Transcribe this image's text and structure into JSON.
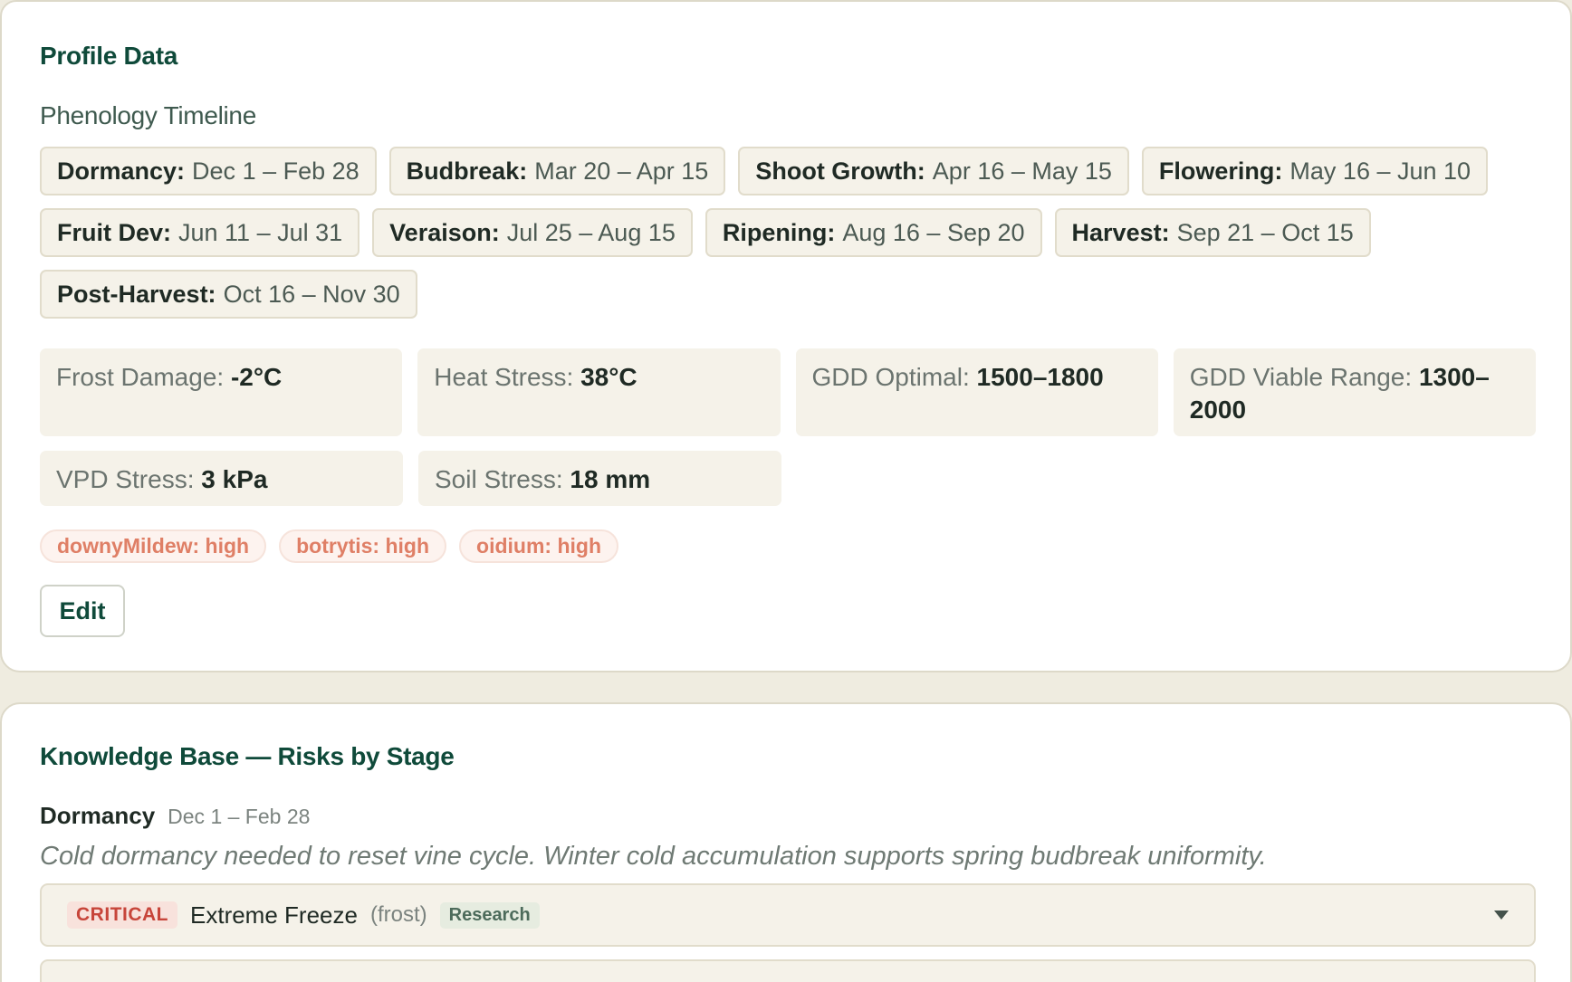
{
  "profile": {
    "title": "Profile Data",
    "phenology_title": "Phenology Timeline",
    "phenology": [
      {
        "stage": "Dormancy:",
        "range": "Dec 1 – Feb 28"
      },
      {
        "stage": "Budbreak:",
        "range": "Mar 20 – Apr 15"
      },
      {
        "stage": "Shoot Growth:",
        "range": "Apr 16 – May 15"
      },
      {
        "stage": "Flowering:",
        "range": "May 16 – Jun 10"
      },
      {
        "stage": "Fruit Dev:",
        "range": "Jun 11 – Jul 31"
      },
      {
        "stage": "Veraison:",
        "range": "Jul 25 – Aug 15"
      },
      {
        "stage": "Ripening:",
        "range": "Aug 16 – Sep 20"
      },
      {
        "stage": "Harvest:",
        "range": "Sep 21 – Oct 15"
      },
      {
        "stage": "Post-Harvest:",
        "range": "Oct 16 – Nov 30"
      }
    ],
    "thresholds": [
      {
        "label": "Frost Damage: ",
        "value": "-2°C"
      },
      {
        "label": "Heat Stress: ",
        "value": "38°C"
      },
      {
        "label": "GDD Optimal: ",
        "value": "1500–1800"
      },
      {
        "label": "GDD Viable Range: ",
        "value": "1300–2000"
      },
      {
        "label": "VPD Stress: ",
        "value": "3 kPa"
      },
      {
        "label": "Soil Stress: ",
        "value": "18 mm"
      }
    ],
    "disease_risks": [
      "downyMildew: high",
      "botrytis: high",
      "oidium: high"
    ],
    "edit_label": "Edit"
  },
  "knowledge_base": {
    "title": "Knowledge Base — Risks by Stage",
    "stage_name": "Dormancy",
    "stage_range": "Dec 1 – Feb 28",
    "stage_description": "Cold dormancy needed to reset vine cycle. Winter cold accumulation supports spring budbreak uniformity.",
    "risks": [
      {
        "severity": "CRITICAL",
        "name": "Extreme Freeze",
        "type": "(frost)",
        "source": "Research"
      }
    ]
  },
  "colors": {
    "brand_green": "#0f4a3a",
    "critical_red": "#c7453a",
    "disease_tag": "#df7f66",
    "page_bg": "#efece0"
  }
}
